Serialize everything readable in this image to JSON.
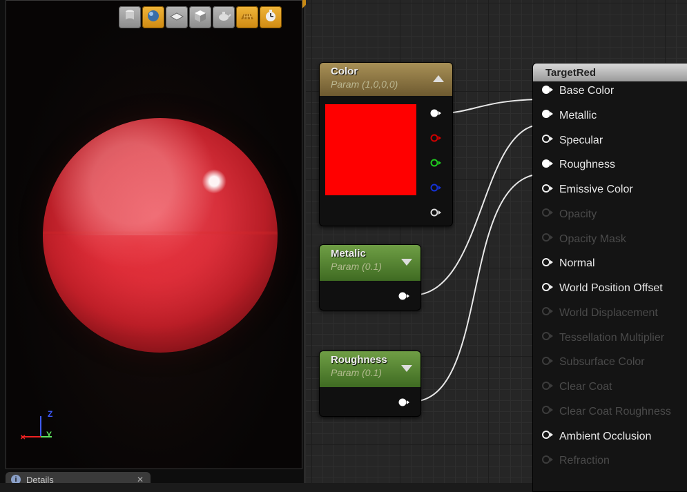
{
  "viewport": {
    "toolbar": [
      {
        "icon": "cylinder-icon",
        "active": false
      },
      {
        "icon": "sphere-icon",
        "active": true
      },
      {
        "icon": "plane-icon",
        "active": false
      },
      {
        "icon": "cube-icon",
        "active": false
      },
      {
        "icon": "teapot-icon",
        "active": false
      },
      {
        "icon": "grid-icon",
        "active": true
      },
      {
        "icon": "realtime-icon",
        "active": true
      }
    ],
    "axis": {
      "z": "Z",
      "y": "Y"
    },
    "details_tab": "Details"
  },
  "nodes": {
    "color": {
      "title": "Color",
      "subtitle": "Param (1,0,0,0)",
      "swatch_color": "#ff0000"
    },
    "metallic": {
      "title": "Metalic",
      "subtitle": "Param (0.1)"
    },
    "roughness": {
      "title": "Roughness",
      "subtitle": "Param (0.1)"
    }
  },
  "result": {
    "title": "TargetRed",
    "inputs": [
      {
        "label": "Base Color",
        "enabled": true,
        "connected": true
      },
      {
        "label": "Metallic",
        "enabled": true,
        "connected": true
      },
      {
        "label": "Specular",
        "enabled": true,
        "connected": false
      },
      {
        "label": "Roughness",
        "enabled": true,
        "connected": true
      },
      {
        "label": "Emissive Color",
        "enabled": true,
        "connected": false
      },
      {
        "label": "Opacity",
        "enabled": false,
        "connected": false
      },
      {
        "label": "Opacity Mask",
        "enabled": false,
        "connected": false
      },
      {
        "label": "Normal",
        "enabled": true,
        "connected": false
      },
      {
        "label": "World Position Offset",
        "enabled": true,
        "connected": false
      },
      {
        "label": "World Displacement",
        "enabled": false,
        "connected": false
      },
      {
        "label": "Tessellation Multiplier",
        "enabled": false,
        "connected": false
      },
      {
        "label": "Subsurface Color",
        "enabled": false,
        "connected": false
      },
      {
        "label": "Clear Coat",
        "enabled": false,
        "connected": false
      },
      {
        "label": "Clear Coat Roughness",
        "enabled": false,
        "connected": false
      },
      {
        "label": "Ambient Occlusion",
        "enabled": true,
        "connected": false
      },
      {
        "label": "Refraction",
        "enabled": false,
        "connected": false
      }
    ]
  },
  "colors": {
    "node_green": "#5f8f36",
    "node_gold": "#8c7340",
    "pin_red": "#d10000",
    "pin_green": "#1fcc1f",
    "pin_blue": "#1432d6"
  }
}
